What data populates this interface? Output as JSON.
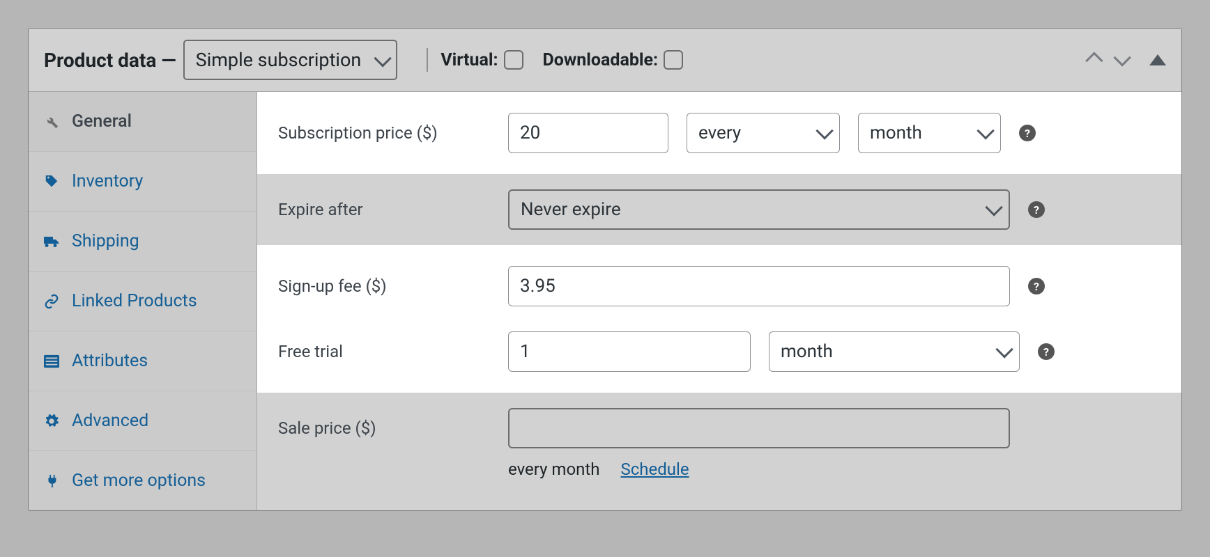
{
  "header": {
    "title": "Product data —",
    "product_type": "Simple subscription",
    "virtual_label": "Virtual:",
    "virtual_checked": false,
    "downloadable_label": "Downloadable:",
    "downloadable_checked": false
  },
  "tabs": [
    {
      "icon": "wrench",
      "label": "General",
      "active": true
    },
    {
      "icon": "tag",
      "label": "Inventory",
      "active": false
    },
    {
      "icon": "truck",
      "label": "Shipping",
      "active": false
    },
    {
      "icon": "link",
      "label": "Linked Products",
      "active": false
    },
    {
      "icon": "list",
      "label": "Attributes",
      "active": false
    },
    {
      "icon": "gear",
      "label": "Advanced",
      "active": false
    },
    {
      "icon": "plug",
      "label": "Get more options",
      "active": false
    }
  ],
  "fields": {
    "sub_price": {
      "label": "Subscription price ($)",
      "value": "20",
      "interval": "every",
      "period": "month"
    },
    "expire": {
      "label": "Expire after",
      "value": "Never expire"
    },
    "signup": {
      "label": "Sign-up fee ($)",
      "value": "3.95"
    },
    "trial": {
      "label": "Free trial",
      "value": "1",
      "period": "month"
    },
    "sale": {
      "label": "Sale price ($)",
      "value": "",
      "note": "every month",
      "schedule": "Schedule"
    }
  }
}
